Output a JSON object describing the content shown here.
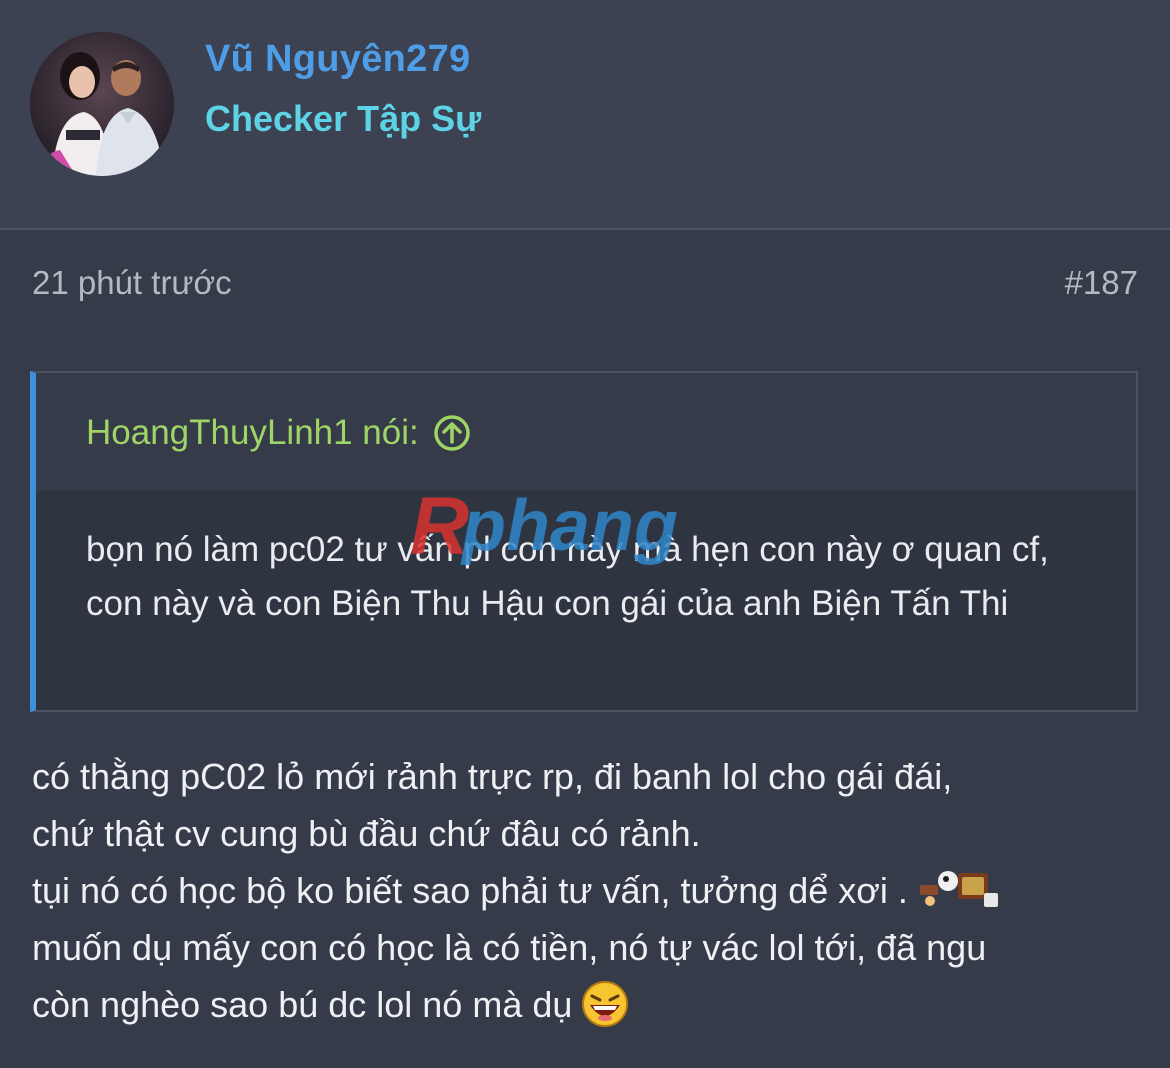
{
  "user": {
    "name": "Vũ Nguyên279",
    "title": "Checker Tập Sự",
    "avatar_icon": "user-avatar-photo"
  },
  "post": {
    "time": "21 phút trước",
    "number": "#187"
  },
  "quote": {
    "author_label": "HoangThuyLinh1 nói:",
    "icon": "arrow-up-circle-icon",
    "body": "bọn nó làm pc02 tư vấn pl con này mà hẹn con này ơ quan cf, con này và con Biện Thu Hậu con gái của anh Biện Tấn Thi"
  },
  "reply": {
    "lines": [
      "có thằng pC02 lỏ mới rảnh trực rp, đi banh lol cho gái đái,",
      "chứ thật cv cung bù đầu chứ đâu có rảnh.",
      "tụi nó có học bộ ko biết sao phải tư vấn, tưởng dể xơi .",
      "muốn dụ mấy con có học là có tiền, nó tự vác lol tới, đã ngu",
      "còn nghèo sao bú dc lol nó mà dụ"
    ],
    "emoji_1": "coffin-dance-emoji",
    "emoji_2": "laughing-emoji"
  },
  "watermark": {
    "text": "phang"
  },
  "colors": {
    "background": "#353b49",
    "username": "#4f9de6",
    "usertitle": "#5fd3e6",
    "quote_author": "#9fd466",
    "quote_border": "#3d8fe0"
  }
}
